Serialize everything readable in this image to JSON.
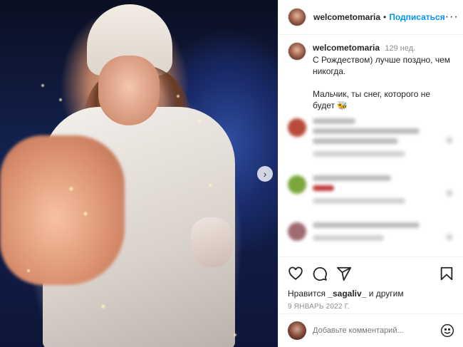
{
  "post": {
    "username": "welcometomaria",
    "follow_label": "Подписаться",
    "more_label": "···",
    "dot": "•",
    "caption_time": "129 нед.",
    "caption_line1": "С Рождеством) лучше поздно, чем никогда.",
    "caption_line2": "Мальчик, ты снег, которого не будет 🐝",
    "likes_prefix": "Нравится",
    "likes_user": "_sagaliv_",
    "likes_suffix": "и другим",
    "date": "9 ЯНВАРЬ 2022 Г.",
    "comment_placeholder": "Добавьте комментарий..."
  },
  "colors": {
    "accent": "#0095f6",
    "muted": "#8e8e8e",
    "text": "#262626"
  },
  "icons": {
    "like": "heart-icon",
    "comment": "comment-icon",
    "share": "share-icon",
    "save": "bookmark-icon",
    "next": "chevron-right-icon",
    "emoji": "smiley-icon"
  }
}
